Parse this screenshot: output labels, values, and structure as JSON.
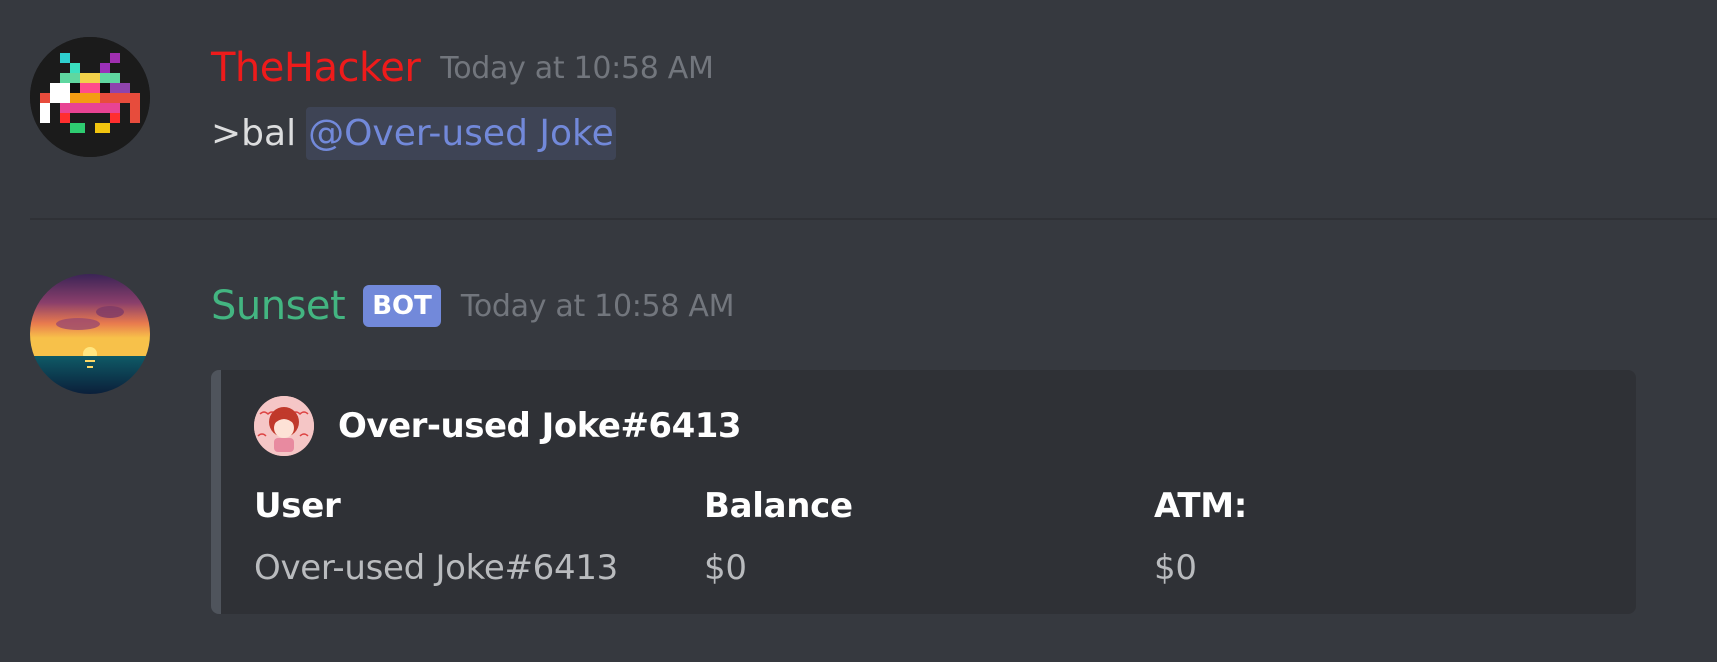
{
  "messages": [
    {
      "username": "TheHacker",
      "timestamp": "Today at 10:58 AM",
      "content_text": ">bal",
      "mention": "@Over-used Joke",
      "avatar_icon": "space-invader-icon",
      "username_color": "#ee1b1b"
    },
    {
      "username": "Sunset",
      "bot_tag": "BOT",
      "timestamp": "Today at 10:58 AM",
      "avatar_icon": "sunset-avatar-icon",
      "username_color": "#43b581",
      "embed": {
        "author": "Over-used Joke#6413",
        "author_icon": "anime-avatar-icon",
        "fields": [
          {
            "name": "User",
            "value": "Over-used Joke#6413"
          },
          {
            "name": "Balance",
            "value": "$0"
          },
          {
            "name": "ATM:",
            "value": "$0"
          }
        ]
      }
    }
  ],
  "colors": {
    "background": "#36393f",
    "embed_background": "#2f3136",
    "embed_border": "#4f545c",
    "mention": "#7289da",
    "bot_tag": "#7289da",
    "timestamp": "#72767d"
  }
}
